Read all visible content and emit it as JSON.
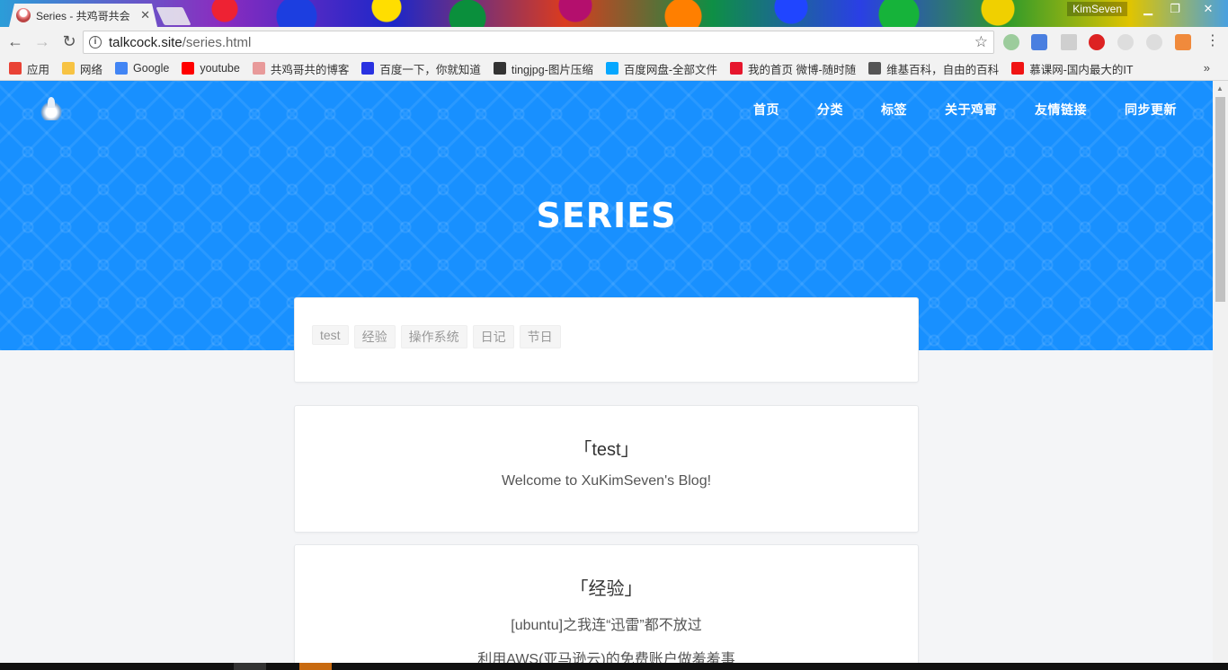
{
  "browser": {
    "tab_title": "Series - 共鸡哥共会",
    "user_name": "KimSeven",
    "url_host": "talkcock.site",
    "url_path": "/series.html",
    "bookmarks": [
      {
        "label": "应用",
        "icon_color": "#e94235"
      },
      {
        "label": "网络",
        "icon_color": "#f7c343"
      },
      {
        "label": "Google",
        "icon_color": "#4285f4"
      },
      {
        "label": "youtube",
        "icon_color": "#ff0000"
      },
      {
        "label": "共鸡哥共的博客",
        "icon_color": "#e89a9a"
      },
      {
        "label": "百度一下，你就知道",
        "icon_color": "#2932e1"
      },
      {
        "label": "tingjpg-图片压缩",
        "icon_color": "#333333"
      },
      {
        "label": "百度网盘-全部文件",
        "icon_color": "#06a7ff"
      },
      {
        "label": "我的首页 微博-随时随",
        "icon_color": "#e6162d"
      },
      {
        "label": "维基百科，自由的百科",
        "icon_color": "#555555"
      },
      {
        "label": "慕课网-国内最大的IT",
        "icon_color": "#f01414"
      }
    ],
    "more_label": "»"
  },
  "site": {
    "nav": [
      "首页",
      "分类",
      "标签",
      "关于鸡哥",
      "友情链接",
      "同步更新"
    ],
    "hero_title": "SERIES",
    "tags": [
      "test",
      "经验",
      "操作系统",
      "日记",
      "节日"
    ],
    "series": [
      {
        "title": "「test」",
        "items": [
          "Welcome to XuKimSeven's Blog!"
        ]
      },
      {
        "title": "「经验」",
        "items": [
          "[ubuntu]之我连“迅雷”都不放过",
          "利用AWS(亚马逊云)的免费账户做羞羞事"
        ]
      }
    ]
  },
  "colors": {
    "accent": "#1890ff",
    "page_bg": "#f4f5f7"
  }
}
